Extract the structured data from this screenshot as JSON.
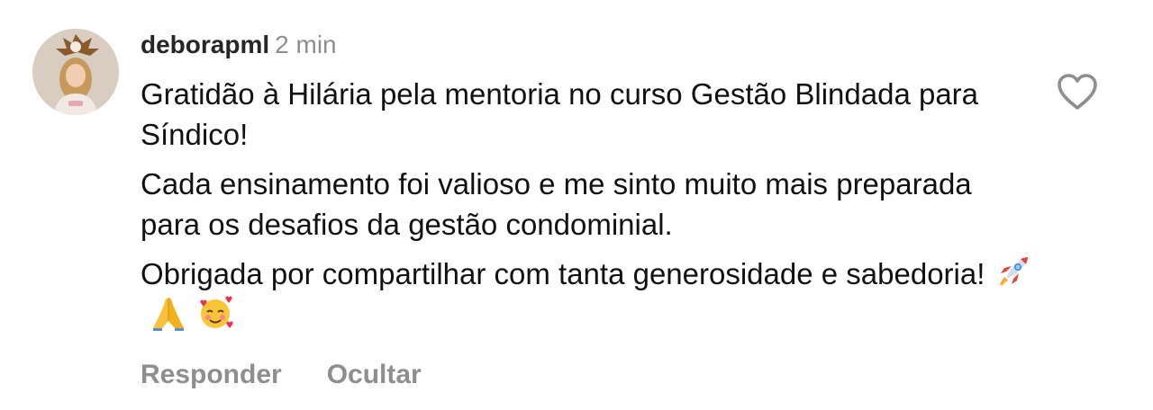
{
  "comment": {
    "username": "deborapml",
    "time_ago": "2 min",
    "paragraphs": [
      "Gratidão à Hilária pela mentoria no curso Gestão Blindada para Síndico!",
      "Cada ensinamento foi valioso e me sinto muito mais preparada para os desafios da gestão condominial.",
      "Obrigada por compartilhar com tanta generosidade e sabedoria!"
    ],
    "emojis": [
      "rocket-emoji",
      "folded-hands-emoji",
      "smiling-face-with-hearts-emoji"
    ],
    "reply_label": "Responder",
    "hide_label": "Ocultar",
    "like_icon": "heart-outline-icon"
  },
  "colors": {
    "text": "#111111",
    "username": "#262626",
    "muted": "#8e8e8e"
  }
}
